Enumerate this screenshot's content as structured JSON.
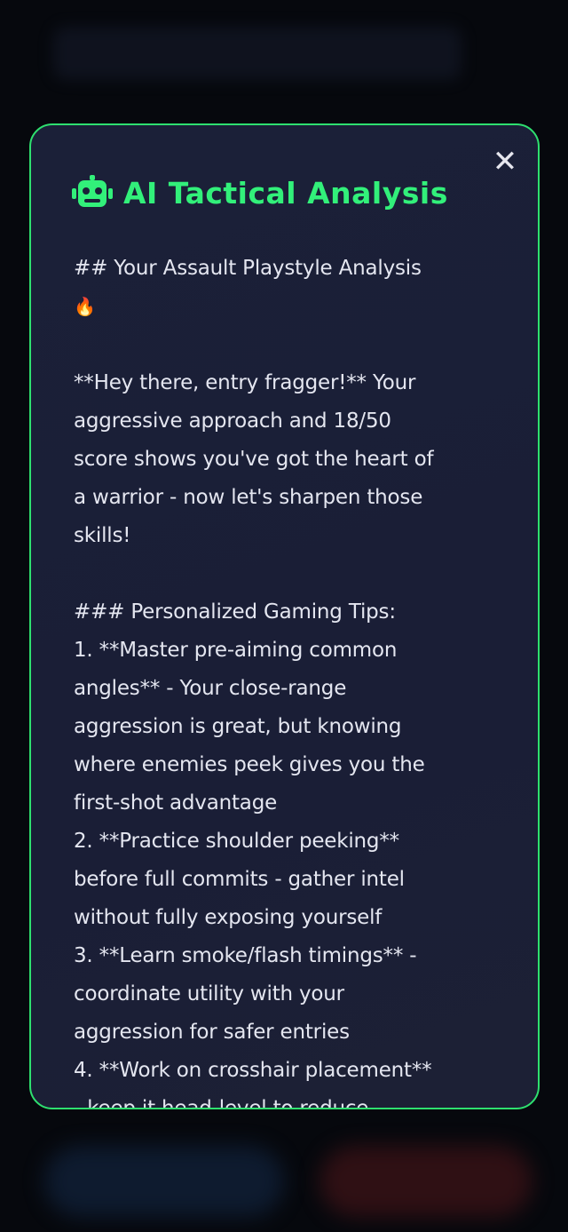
{
  "modal": {
    "title": "AI Tactical Analysis",
    "close_label": "✕",
    "lines": [
      "## Your Assault Playstyle Analysis",
      "🔥",
      "",
      "**Hey there, entry fragger!** Your",
      "aggressive approach and 18/50",
      "score shows you've got the heart of",
      "a warrior - now let's sharpen those",
      "skills!",
      "",
      "### Personalized Gaming Tips:",
      "1. **Master pre-aiming common",
      "angles** - Your close-range",
      "aggression is great, but knowing",
      "where enemies peek gives you the",
      "first-shot advantage",
      "2. **Practice shoulder peeking**",
      "before full commits - gather intel",
      "without fully exposing yourself",
      "3. **Learn smoke/flash timings** -",
      "coordinate utility with your",
      "aggression for safer entries",
      "4. **Work on crosshair placement**",
      "- keep it head-level to reduce"
    ]
  },
  "colors": {
    "accent": "#2ee06f",
    "modal_bg": "#1b2038",
    "text": "#e4e6f0"
  }
}
